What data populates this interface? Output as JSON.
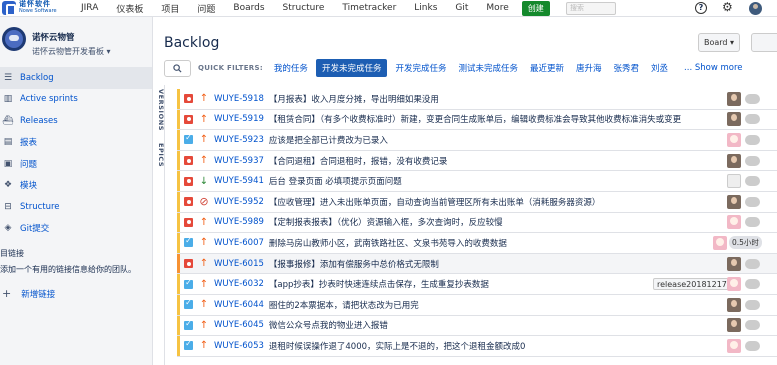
{
  "topbar": {
    "logo_text": "诺怀软件",
    "logo_sub": "Nowe Software",
    "nav": [
      "JIRA",
      "仪表板",
      "项目",
      "问题",
      "Boards",
      "Structure",
      "Timetracker",
      "Links",
      "Git",
      "More"
    ],
    "create_label": "创建",
    "search_placeholder": "搜索"
  },
  "sidebar": {
    "project_name": "诺怀云物管",
    "project_board": "诺怀云物管开发看板 ▾",
    "items": [
      {
        "label": "Backlog",
        "icon": "backlog-icon",
        "glyph": "☰",
        "active": true
      },
      {
        "label": "Active sprints",
        "icon": "board-icon",
        "glyph": "▥"
      },
      {
        "label": "Releases",
        "icon": "ship-icon",
        "glyph": "⛴"
      },
      {
        "label": "报表",
        "icon": "chart-icon",
        "glyph": "▤"
      },
      {
        "label": "问题",
        "icon": "issues-icon",
        "glyph": "▣"
      },
      {
        "label": "模块",
        "icon": "component-icon",
        "glyph": "❖"
      },
      {
        "label": "Structure",
        "icon": "structure-icon",
        "glyph": "⊟"
      },
      {
        "label": "Git提交",
        "icon": "git-icon",
        "glyph": "◈"
      }
    ],
    "link_heading": "目链接",
    "link_desc": "添加一个有用的链接信息给你的团队。",
    "add_link": "新增链接"
  },
  "main": {
    "title": "Backlog",
    "board_button": "Board ▾",
    "filter_label": "QUICK FILTERS:",
    "filters": [
      {
        "label": "我的任务",
        "active": false
      },
      {
        "label": "开发未完成任务",
        "active": true
      },
      {
        "label": "开发完成任务",
        "active": false
      },
      {
        "label": "测试未完成任务",
        "active": false
      },
      {
        "label": "最近更新",
        "active": false
      },
      {
        "label": "唐升海",
        "active": false
      },
      {
        "label": "张秀君",
        "active": false
      },
      {
        "label": "刘丞",
        "active": false
      }
    ],
    "show_more": "... Show more",
    "side_tabs": [
      "VERSIONS",
      "EPICS"
    ]
  },
  "issues": [
    {
      "type": "bug",
      "priority": "high",
      "key": "WUYE-5918",
      "summary": "【月报表】收入月度分摊，导出明细如果没用",
      "avatar": "m"
    },
    {
      "type": "bug",
      "priority": "high",
      "key": "WUYE-5919",
      "summary": "【租赁合同】（有多个收费标准时）新建，变更合同生成账单后，编辑收费标准会导致其他收费标准消失或变更",
      "avatar": "m"
    },
    {
      "type": "task",
      "priority": "high",
      "key": "WUYE-5923",
      "summary": "应该是把全部已计费改为已录入",
      "avatar": "f"
    },
    {
      "type": "bug",
      "priority": "high",
      "key": "WUYE-5937",
      "summary": "【合同退租】合同退租时，报错，没有收费记录",
      "avatar": "m"
    },
    {
      "type": "bug",
      "priority": "low",
      "key": "WUYE-5941",
      "summary": "后台 登录页面 必填项提示页面问题",
      "avatar": "e"
    },
    {
      "type": "bug",
      "priority": "blocker",
      "key": "WUYE-5952",
      "summary": "【应收管理】进入未出账单页面，自动查询当前管理区所有未出账单（消耗服务器资源）",
      "avatar": "m"
    },
    {
      "type": "bug",
      "priority": "high",
      "key": "WUYE-5989",
      "summary": "【定制报表报表】（优化）资源输入框，多次查询时，反应较慢",
      "avatar": "f"
    },
    {
      "type": "task",
      "priority": "high",
      "key": "WUYE-6007",
      "summary": "删除马房山教师小区，武南铁路社区、文泉书苑导入的收费数据",
      "avatar": "f",
      "estimate": "0.5小时"
    },
    {
      "type": "bug",
      "priority": "high",
      "key": "WUYE-6015",
      "summary": "【报事报修】添加有偿服务中总价格式无限制",
      "avatar": "m",
      "grey": true
    },
    {
      "type": "task",
      "priority": "high",
      "key": "WUYE-6032",
      "summary": "【app抄表】抄表时快速连续点击保存，生成重复抄表数据",
      "avatar": "f",
      "release": "release20181217"
    },
    {
      "type": "task",
      "priority": "high",
      "key": "WUYE-6044",
      "summary": "圈住的2本票据本，请把状态改为已用完",
      "avatar": "m"
    },
    {
      "type": "task",
      "priority": "high",
      "key": "WUYE-6045",
      "summary": "微信公众号点我的物业进入报错",
      "avatar": "m"
    },
    {
      "type": "task",
      "priority": "high",
      "key": "WUYE-6053",
      "summary": "退租时候误操作退了4000，实际上是不退的，把这个退租金额改成0",
      "avatar": "f"
    }
  ]
}
